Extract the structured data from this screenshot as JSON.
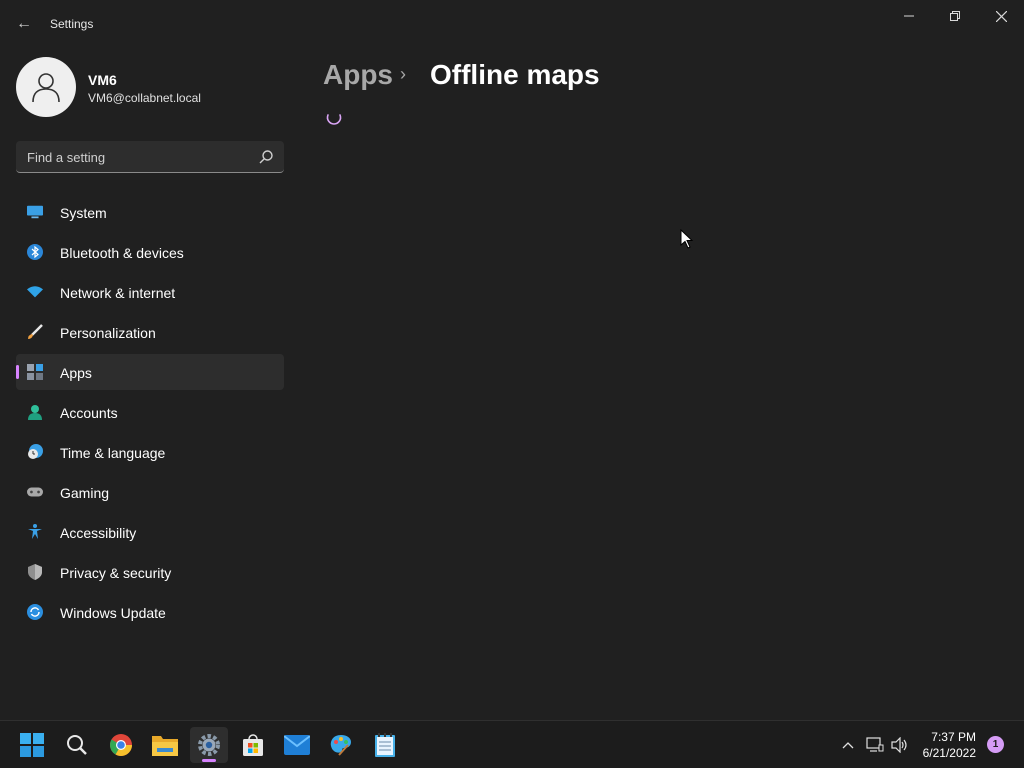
{
  "window": {
    "title": "Settings",
    "back_glyph": "←",
    "controls": [
      "minimize-icon",
      "restore-icon",
      "close-icon"
    ]
  },
  "profile": {
    "name": "VM6",
    "email": "VM6@collabnet.local"
  },
  "search": {
    "placeholder": "Find a setting"
  },
  "nav": {
    "items": [
      {
        "label": "System",
        "icon": "system-icon",
        "selected": false
      },
      {
        "label": "Bluetooth & devices",
        "icon": "bluetooth-icon",
        "selected": false
      },
      {
        "label": "Network & internet",
        "icon": "wifi-icon",
        "selected": false
      },
      {
        "label": "Personalization",
        "icon": "brush-icon",
        "selected": false
      },
      {
        "label": "Apps",
        "icon": "apps-icon",
        "selected": true
      },
      {
        "label": "Accounts",
        "icon": "person-icon",
        "selected": false
      },
      {
        "label": "Time & language",
        "icon": "clock-globe-icon",
        "selected": false
      },
      {
        "label": "Gaming",
        "icon": "gamepad-icon",
        "selected": false
      },
      {
        "label": "Accessibility",
        "icon": "accessibility-icon",
        "selected": false
      },
      {
        "label": "Privacy & security",
        "icon": "shield-icon",
        "selected": false
      },
      {
        "label": "Windows Update",
        "icon": "update-icon",
        "selected": false
      }
    ]
  },
  "breadcrumb": {
    "parent": "Apps",
    "separator": "›",
    "current": "Offline maps"
  },
  "taskbar": {
    "apps": [
      "start-icon",
      "search-icon",
      "chrome-icon",
      "file-explorer-icon",
      "settings-icon",
      "store-icon",
      "mail-icon",
      "paint-icon",
      "notepad-icon"
    ],
    "active_app": "settings-icon"
  },
  "tray": {
    "time": "7:37 PM",
    "date": "6/21/2022",
    "notification_count": "1"
  },
  "colors": {
    "background": "#202020",
    "accent": "#d783ff",
    "taskbar": "#1c1c1c"
  }
}
